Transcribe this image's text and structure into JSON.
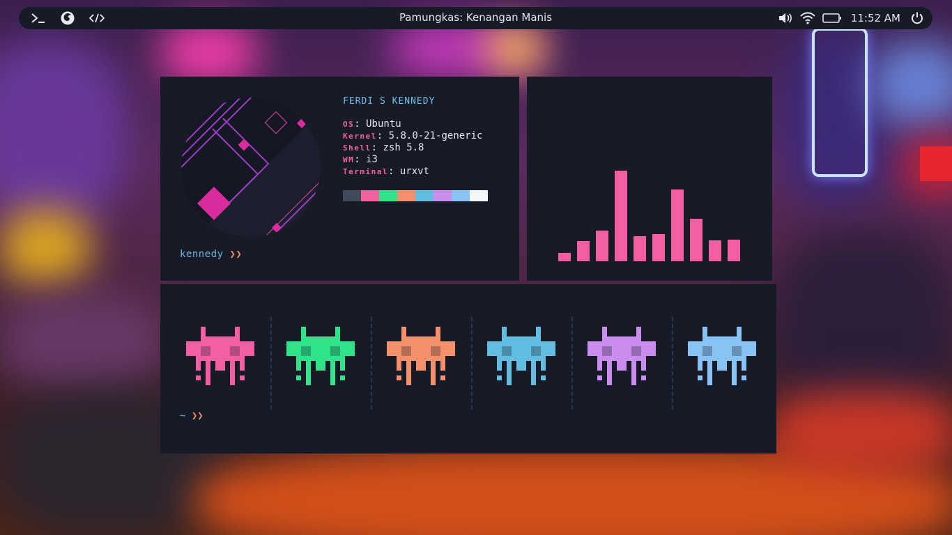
{
  "topbar": {
    "title": "Pamungkas: Kenangan Manis",
    "clock": "11:52 AM",
    "icons": [
      "terminal-icon",
      "firefox-icon",
      "code-icon",
      "volume-icon",
      "wifi-icon",
      "battery-icon",
      "power-icon"
    ]
  },
  "info": {
    "username_heading": "FERDI S KENNEDY",
    "rows": [
      {
        "key": "OS",
        "value": "Ubuntu"
      },
      {
        "key": "Kernel",
        "value": "5.8.0-21-generic"
      },
      {
        "key": "Shell",
        "value": "zsh 5.8"
      },
      {
        "key": "WM",
        "value": "i3"
      },
      {
        "key": "Terminal",
        "value": "urxvt"
      }
    ],
    "prompt_user": "kennedy",
    "prompt_arrows": "❯❯",
    "palette": [
      "#414a5a",
      "#f2609f",
      "#2ee38a",
      "#f5916a",
      "#62bde0",
      "#cb8cef",
      "#88c3f5",
      "#f4f6f8"
    ]
  },
  "visualizer": {
    "color": "#f45fa2",
    "levels": [
      0.09,
      0.22,
      0.34,
      1.0,
      0.28,
      0.3,
      0.79,
      0.47,
      0.23,
      0.24
    ]
  },
  "invaders": {
    "colors": [
      "#f45fa2",
      "#2ee38a",
      "#f5916a",
      "#62bde0",
      "#cb8cef",
      "#88c3f5"
    ],
    "prompt_tilde": "~",
    "prompt_arrows": "❯❯"
  }
}
